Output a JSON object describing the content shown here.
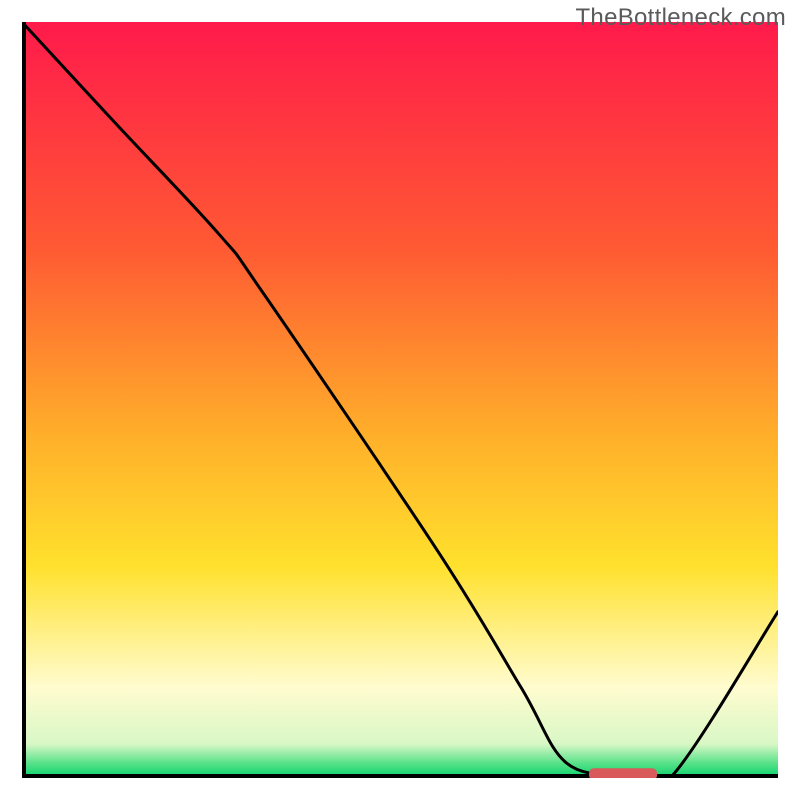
{
  "watermark": "TheBottleneck.com",
  "chart_data": {
    "type": "line",
    "title": "",
    "xlabel": "",
    "ylabel": "",
    "xlim": [
      0,
      100
    ],
    "ylim": [
      0,
      100
    ],
    "grid": false,
    "legend": false,
    "gradient_stops": [
      {
        "offset": 0,
        "color": "#ff1a4b"
      },
      {
        "offset": 0.3,
        "color": "#ff5a33"
      },
      {
        "offset": 0.55,
        "color": "#ffb02a"
      },
      {
        "offset": 0.72,
        "color": "#ffe12d"
      },
      {
        "offset": 0.88,
        "color": "#fffccf"
      },
      {
        "offset": 0.955,
        "color": "#d9f7c6"
      },
      {
        "offset": 0.98,
        "color": "#5ae28a"
      },
      {
        "offset": 1.0,
        "color": "#06d36b"
      }
    ],
    "series": [
      {
        "name": "bottleneck-curve",
        "x": [
          0.0,
          12,
          26,
          32,
          55,
          66,
          72,
          80,
          86,
          100
        ],
        "y": [
          100.0,
          87,
          72,
          64,
          30,
          12,
          2,
          0.3,
          0.3,
          22
        ]
      }
    ],
    "optimal_marker": {
      "x_start": 75,
      "x_end": 84,
      "y": 0.5,
      "color": "#d85a5a"
    },
    "axis_color": "#000000",
    "curve_color": "#000000",
    "curve_width": 3
  }
}
